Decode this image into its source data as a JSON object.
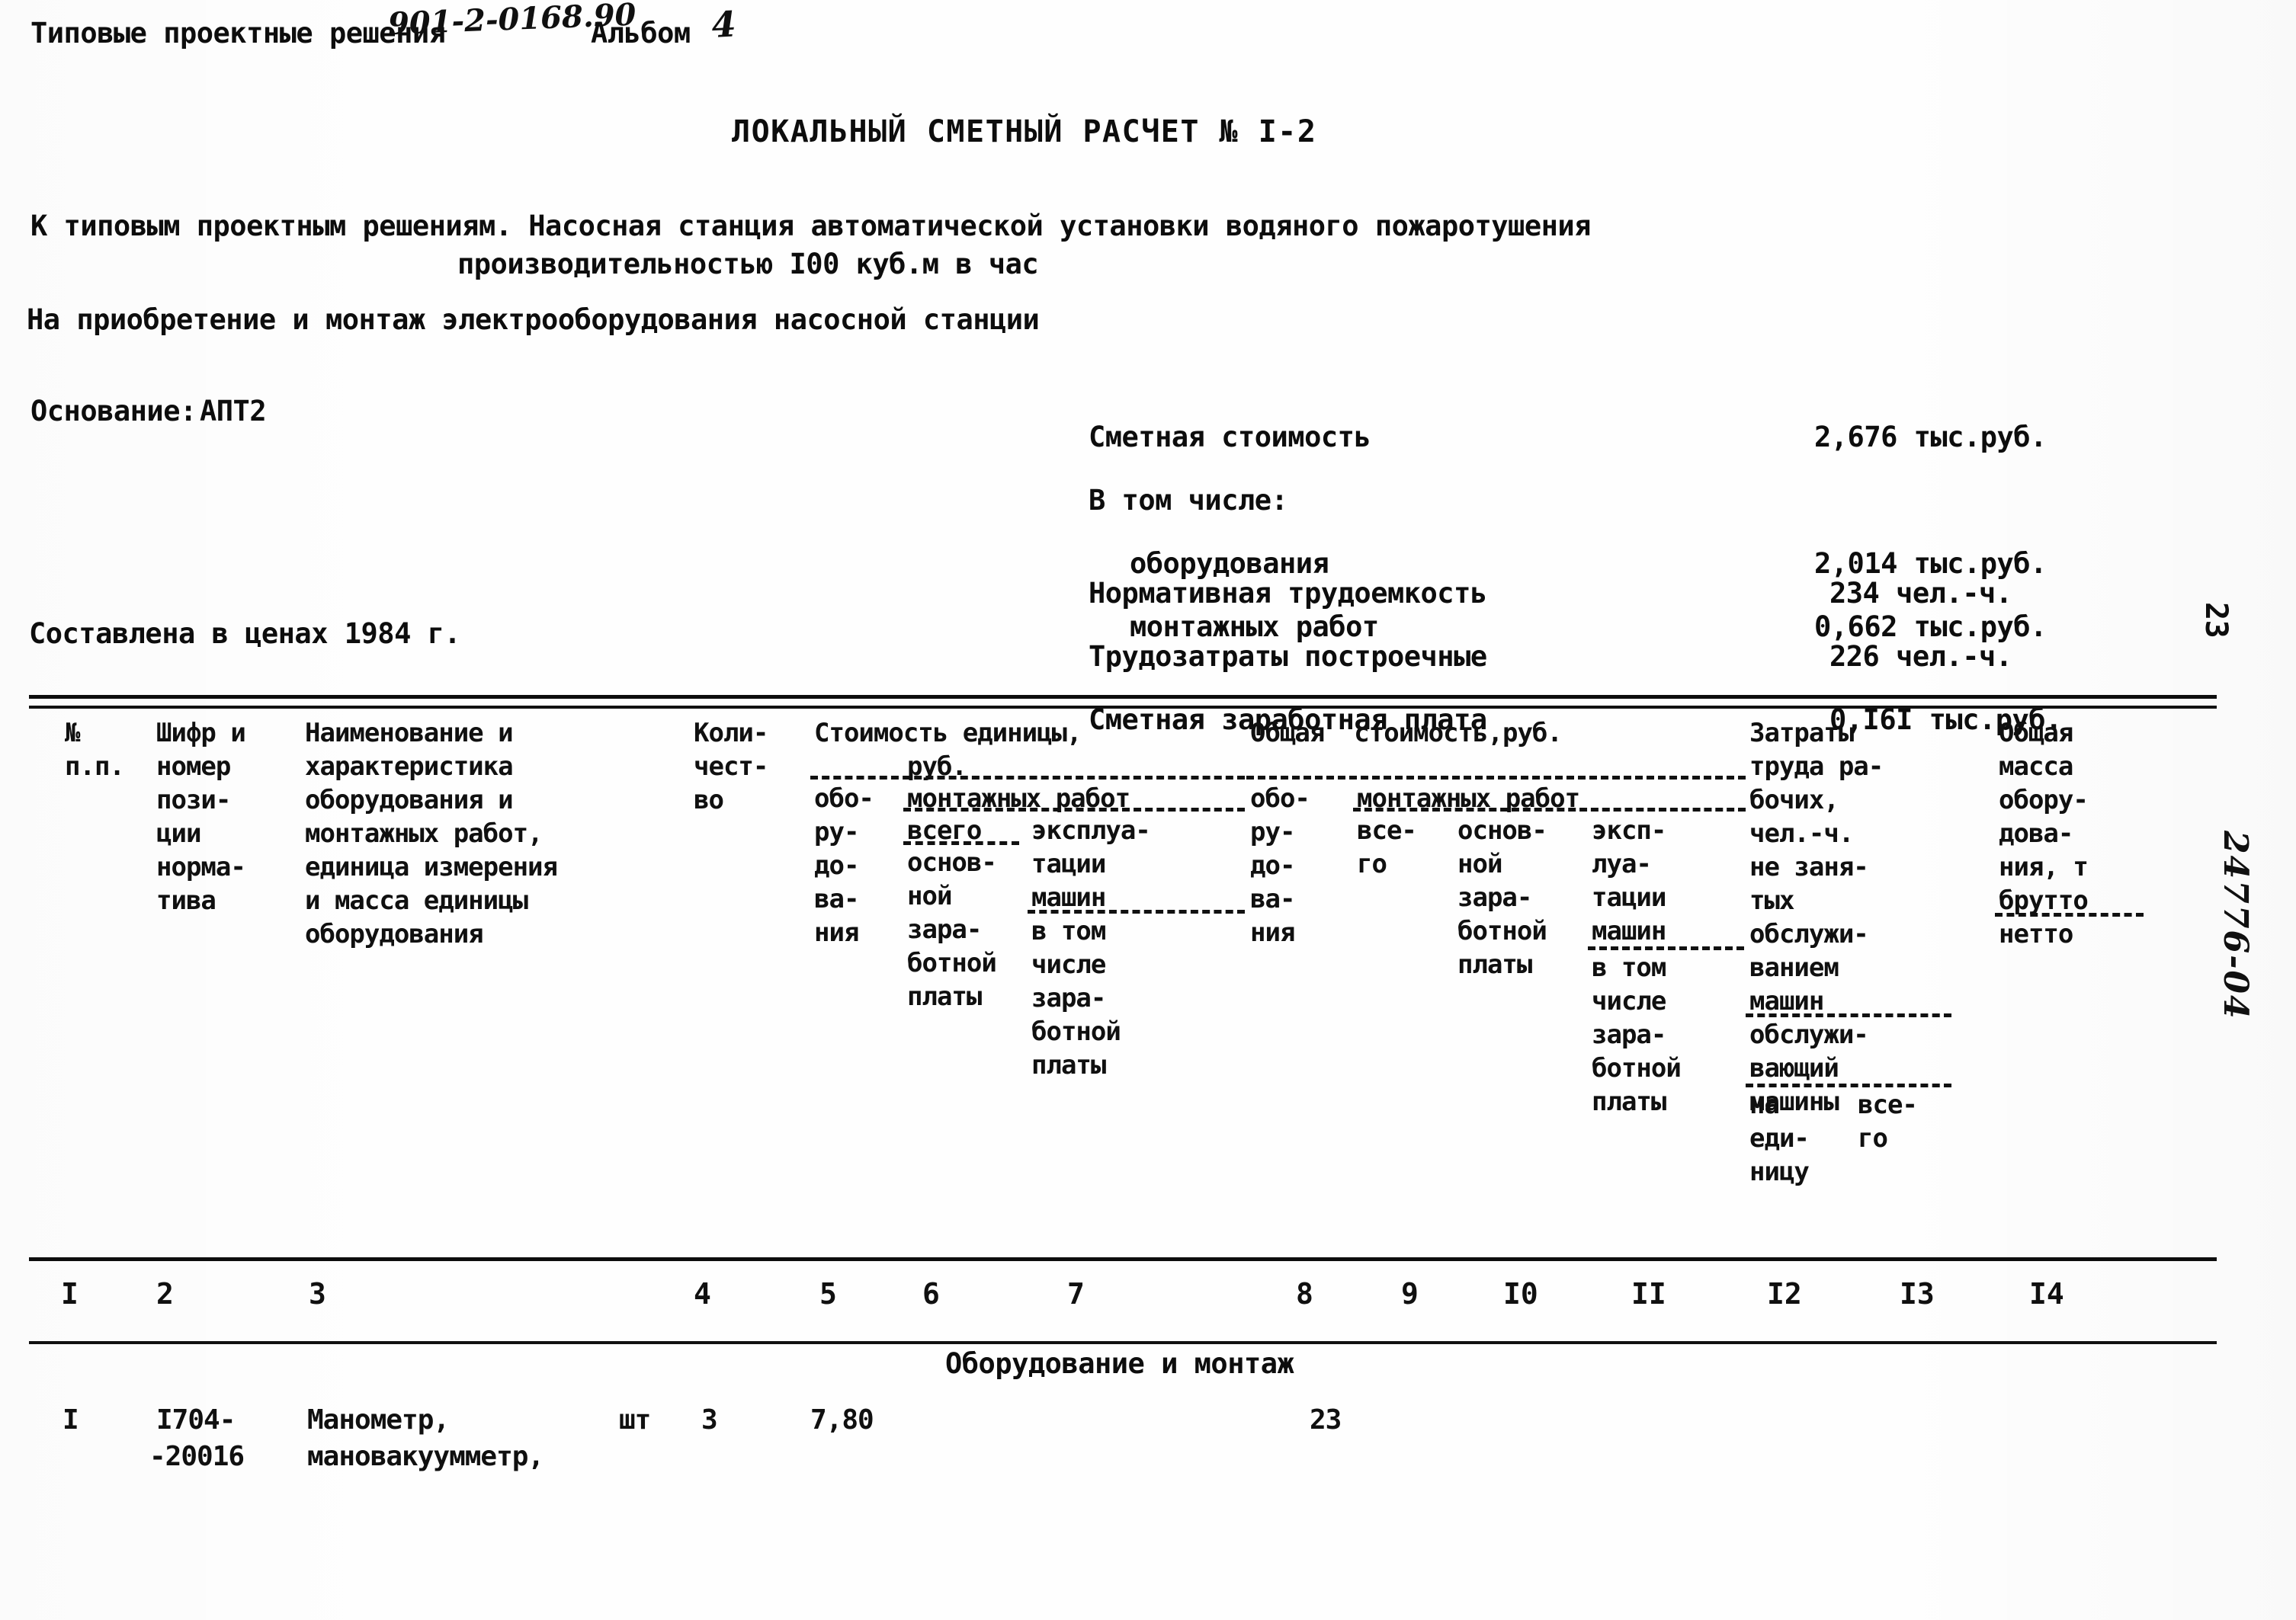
{
  "header": {
    "series_label": "Типовые проектные решения",
    "series_code": "901-2-0168.90",
    "album_label": "Альбом",
    "album_number": "4",
    "doc_title": "ЛОКАЛЬНЫЙ СМЕТНЫЙ РАСЧЕТ № I-2"
  },
  "intro": {
    "line1": "К типовым проектным решениям. Насосная станция автоматической установки водяного пожаротушения",
    "line2": "производительностью I00 куб.м в час",
    "line3": "На приобретение и монтаж электрооборудования насосной станции"
  },
  "basis": {
    "label": "Основание:",
    "value": "АПТ2",
    "prices_line": "Составлена в ценах 1984 г."
  },
  "summary": {
    "rows": [
      {
        "label": "Сметная стоимость",
        "value": "2,676 тыс.руб."
      },
      {
        "label": "В том числе:",
        "value": ""
      },
      {
        "label": "оборудования",
        "value": "2,014 тыс.руб."
      },
      {
        "label": "монтажных работ",
        "value": "0,662 тыс.руб."
      }
    ],
    "rows2": [
      {
        "label": "Нормативная трудоемкость",
        "value": "234 чел.-ч."
      },
      {
        "label": "Трудозатраты построечные",
        "value": "226 чел.-ч."
      },
      {
        "label": "Сметная заработная плата",
        "value": "0,I6I тыс.руб."
      }
    ]
  },
  "margin": {
    "page_number": "23",
    "archive_code": "24776-04"
  },
  "table": {
    "headers": {
      "c1": "№\nп.п.",
      "c2": "Шифр и\nномер\nпози-\nции\nнорма-\nтива",
      "c3": "Наименование и\nхарактеристика\nоборудования и\nмонтажных работ,\nединица измерения\nи масса единицы\nоборудования",
      "c4": "Коли-\nчест-\nво",
      "group_unit_cost": "Стоимость единицы,",
      "group_unit_cost_2": "руб.",
      "c5": "обо-\nру-\nдо-\nва-\nния",
      "group_install_1": "монтажных работ",
      "c6": "всего",
      "c6b": "основ-\nной\nзара-\nботной\nплаты",
      "c7": "эксплуа-\nтации\nмашин",
      "c7b": "в том\nчисле\nзара-\nботной\nплаты",
      "group_total_cost": "Общая  стоимость,руб.",
      "c8": "обо-\nру-\nдо-\nва-\nния",
      "group_install_2": "монтажных работ",
      "c9": "все-\nго",
      "c10": "основ-\nной\nзара-\nботной\nплаты",
      "c11": "эксп-\nлуа-\nтации\nмашин",
      "c11b": "в том\nчисле\nзара-\nботной\nплаты",
      "c12a": "Затраты\nтруда ра-\nбочих,\nчел.-ч.\nне заня-\nтых\nобслужи-\nванием\nмашин",
      "c12b": "обслужи-\nвающий\nмашины",
      "c12c": "на\nеди-\nницу",
      "c13": "все-\nго",
      "c14a": "Общая\nмасса\nобору-\nдова-\nния, т\nбрутто",
      "c14b": "нетто"
    },
    "column_numbers": [
      "I",
      "2",
      "3",
      "4",
      "5",
      "6",
      "7",
      "8",
      "9",
      "I0",
      "II",
      "I2",
      "I3",
      "I4"
    ],
    "section_title": "Оборудование и монтаж",
    "rows": [
      {
        "num": "I",
        "code_line1": "I704-",
        "code_line2": "-20016",
        "name_line1": "Манометр,",
        "name_line2": "мановакуумметр,",
        "unit": "шт",
        "qty": "3",
        "unit_equip_cost": "7,80",
        "total_equip_cost": "23"
      }
    ]
  }
}
